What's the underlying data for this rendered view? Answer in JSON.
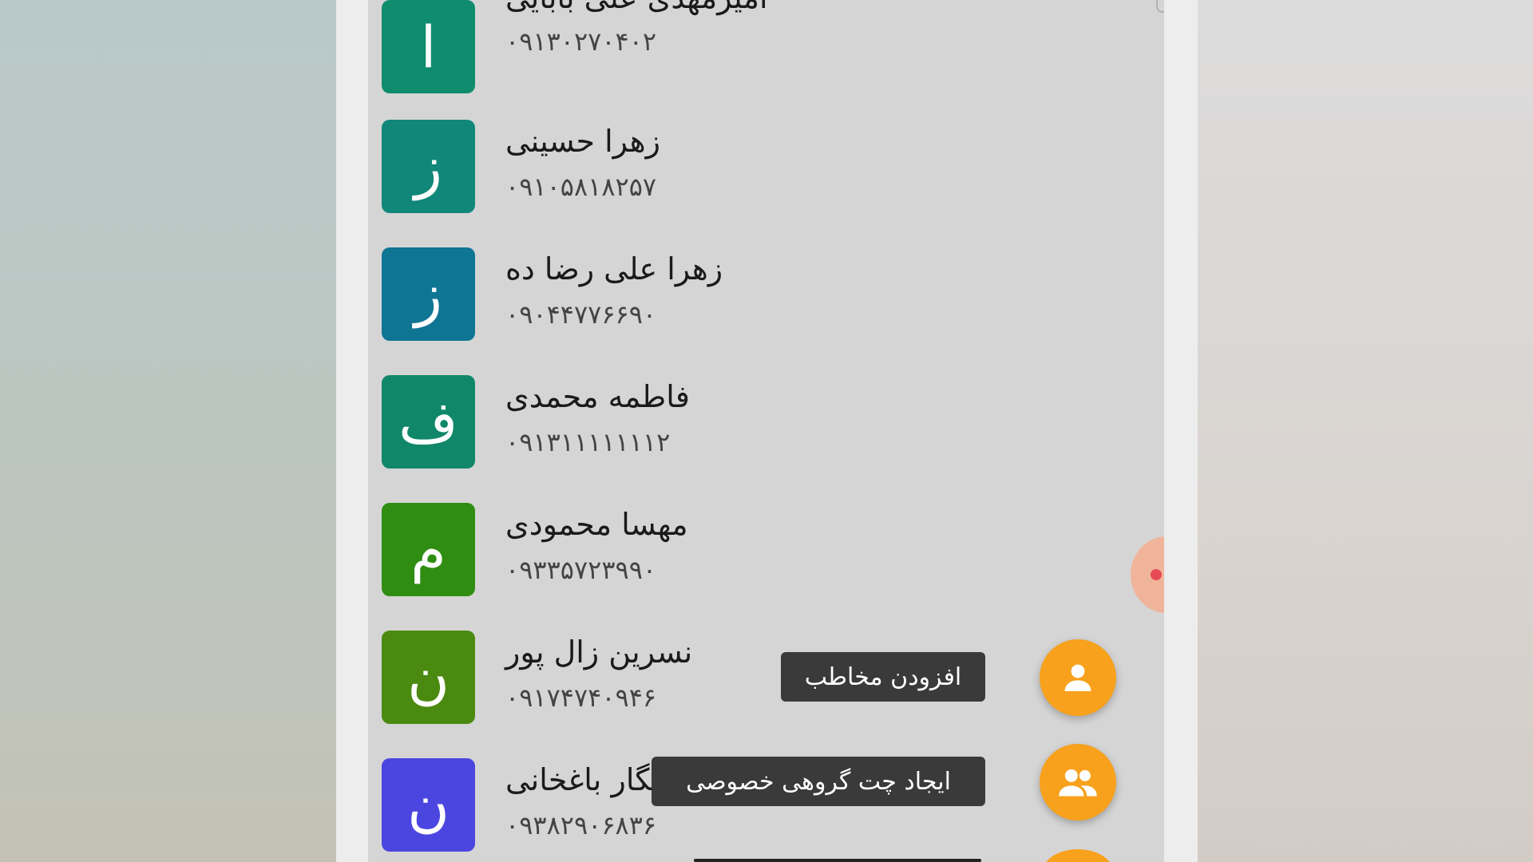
{
  "contacts": [
    {
      "initial": "ا",
      "name": "امیرمهدی علی بابایی",
      "phone": "۰۹۱۳۰۲۷۰۴۰۲",
      "color": "#0f8c6e"
    },
    {
      "initial": "ز",
      "name": "زهرا حسینی",
      "phone": "۰۹۱۰۵۸۱۸۲۵۷",
      "color": "#108779"
    },
    {
      "initial": "ز",
      "name": "زهرا علی رضا ده",
      "phone": "۰۹۰۴۴۷۷۶۶۹۰",
      "color": "#0e7593"
    },
    {
      "initial": "ف",
      "name": "فاطمه محمدی",
      "phone": "۰۹۱۳۱۱۱۱۱۱۱۲",
      "color": "#108769"
    },
    {
      "initial": "م",
      "name": "مهسا محمودی",
      "phone": "۰۹۳۳۵۷۲۳۹۹۰",
      "color": "#2f8e12"
    },
    {
      "initial": "ن",
      "name": "نسرین زال پور",
      "phone": "۰۹۱۷۴۷۴۰۹۴۶",
      "color": "#4a8a10"
    },
    {
      "initial": "ن",
      "name": "نگار باغخانی",
      "phone": "۰۹۳۸۲۹۰۶۸۳۶",
      "color": "#4c46e0"
    }
  ],
  "actions": {
    "add_contact": {
      "label": "افزودن مخاطب",
      "icon": "person-icon"
    },
    "create_group": {
      "label": "ایجاد چت گروهی خصوصی",
      "icon": "group-icon"
    }
  },
  "colors": {
    "fab": "#f7a11c",
    "tooltip_bg": "#3a3a3a",
    "screen_bg": "#d5d5d5"
  }
}
